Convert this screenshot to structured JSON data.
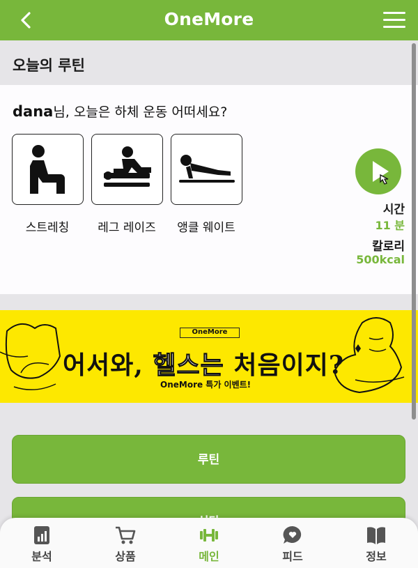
{
  "header": {
    "title": "OneMore",
    "back_icon": "chevron-left-icon",
    "menu_icon": "hamburger-menu-icon"
  },
  "section": {
    "title": "오늘의 루틴"
  },
  "routine": {
    "user": "dana",
    "greeting_suffix": "님, 오늘은 하체 운동 어떠세요?",
    "exercises": [
      {
        "label": "스트레칭",
        "icon": "stretching-icon"
      },
      {
        "label": "레그 레이즈",
        "icon": "leg-raise-icon"
      },
      {
        "label": "앵클 웨이트",
        "icon": "ankle-weight-icon"
      }
    ],
    "play_icon": "play-icon",
    "time_label": "시간",
    "time_value": "11 분",
    "calorie_label": "칼로리",
    "calorie_value": "500kcal"
  },
  "banner": {
    "tag": "OneMore",
    "headline_pre": "어서와, ",
    "headline_hi": "헬스는",
    "headline_post": " 처음이지?",
    "sub": "OneMore 특가 이벤트!"
  },
  "buttons": {
    "routine": "루틴",
    "second": "식단"
  },
  "nav": [
    {
      "label": "분석",
      "icon": "analytics-icon"
    },
    {
      "label": "상품",
      "icon": "cart-icon"
    },
    {
      "label": "메인",
      "icon": "dumbbell-icon",
      "active": true
    },
    {
      "label": "피드",
      "icon": "chat-heart-icon"
    },
    {
      "label": "정보",
      "icon": "book-icon"
    }
  ],
  "colors": {
    "brand": "#78b73b",
    "banner_bg": "#fde800"
  }
}
